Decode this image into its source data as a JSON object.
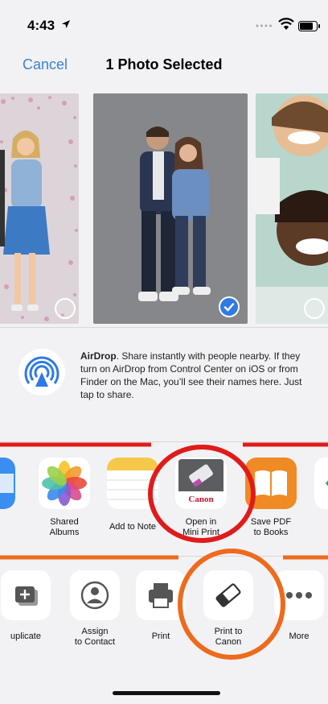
{
  "status_bar": {
    "time": "4:43"
  },
  "nav": {
    "cancel": "Cancel",
    "title": "1 Photo Selected"
  },
  "airdrop": {
    "title": "AirDrop",
    "body": ". Share instantly with people nearby. If they turn on AirDrop from Control Center on iOS or from Finder on the Mac, you’ll see their names here. Just tap to share."
  },
  "apps": [
    {
      "label_line1": "",
      "label_line2": "",
      "icon": "mail-icon"
    },
    {
      "label_line1": "Shared",
      "label_line2": "Albums",
      "icon": "photos-icon"
    },
    {
      "label_line1": "Add to Note",
      "label_line2": "",
      "icon": "notes-icon"
    },
    {
      "label_line1": "Open in",
      "label_line2": "Mini Print",
      "icon": "canon-mini-print-icon",
      "brand": "Canon"
    },
    {
      "label_line1": "Save PDF",
      "label_line2": "to Books",
      "icon": "books-icon"
    }
  ],
  "actions": [
    {
      "label_line1": "uplicate",
      "label_line2": "",
      "icon": "duplicate-icon"
    },
    {
      "label_line1": "Assign",
      "label_line2": "to Contact",
      "icon": "contact-icon"
    },
    {
      "label_line1": "Print",
      "label_line2": "",
      "icon": "printer-icon"
    },
    {
      "label_line1": "Print to",
      "label_line2": "Canon",
      "icon": "canon-print-icon"
    },
    {
      "label_line1": "More",
      "label_line2": "",
      "icon": "more-icon"
    }
  ],
  "colors": {
    "accent": "#2f7ae5",
    "highlight_red": "#e01b1b",
    "highlight_orange": "#ee6a1c"
  }
}
